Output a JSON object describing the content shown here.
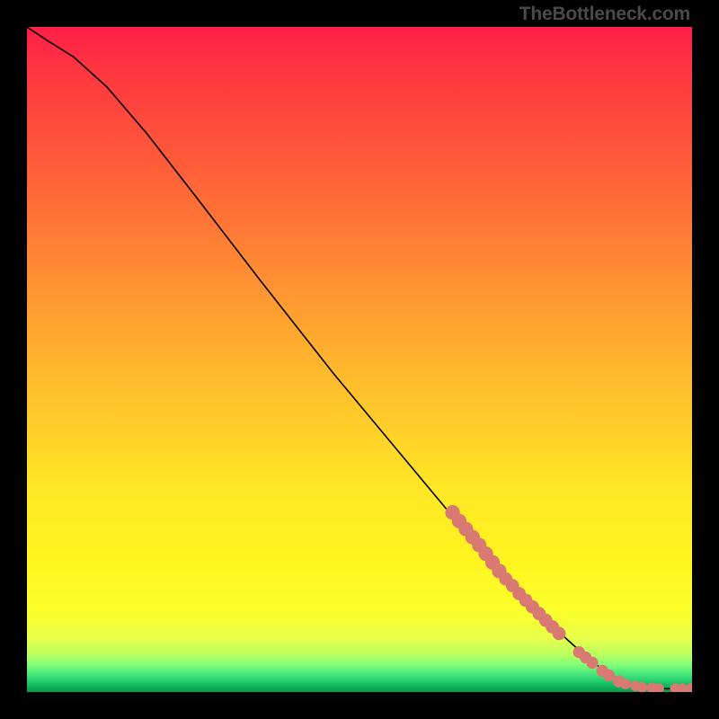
{
  "watermark": "TheBottleneck.com",
  "chart_data": {
    "type": "line",
    "title": "",
    "xlabel": "",
    "ylabel": "",
    "xlim": [
      0,
      100
    ],
    "ylim": [
      0,
      100
    ],
    "grid": false,
    "legend": false,
    "curve": [
      {
        "x": 0,
        "y": 100
      },
      {
        "x": 3,
        "y": 98
      },
      {
        "x": 7,
        "y": 95.5
      },
      {
        "x": 12,
        "y": 91
      },
      {
        "x": 18,
        "y": 84
      },
      {
        "x": 25,
        "y": 75
      },
      {
        "x": 35,
        "y": 62
      },
      {
        "x": 46,
        "y": 48
      },
      {
        "x": 56,
        "y": 36
      },
      {
        "x": 66,
        "y": 24
      },
      {
        "x": 74,
        "y": 15
      },
      {
        "x": 80,
        "y": 9
      },
      {
        "x": 85,
        "y": 4.5
      },
      {
        "x": 89,
        "y": 1.8
      },
      {
        "x": 92,
        "y": 0.8
      },
      {
        "x": 95,
        "y": 0.5
      },
      {
        "x": 100,
        "y": 0.5
      }
    ],
    "marker_clusters": [
      {
        "x": 64,
        "y": 27.0,
        "r": 1.1
      },
      {
        "x": 65,
        "y": 25.7,
        "r": 1.1
      },
      {
        "x": 66,
        "y": 24.5,
        "r": 1.1
      },
      {
        "x": 67,
        "y": 23.3,
        "r": 1.1
      },
      {
        "x": 68,
        "y": 22.1,
        "r": 1.1
      },
      {
        "x": 69,
        "y": 20.8,
        "r": 1.1
      },
      {
        "x": 70,
        "y": 19.5,
        "r": 1.1
      },
      {
        "x": 71,
        "y": 18.2,
        "r": 1.1
      },
      {
        "x": 72,
        "y": 17.0,
        "r": 1.0
      },
      {
        "x": 73,
        "y": 16.0,
        "r": 1.0
      },
      {
        "x": 74,
        "y": 14.8,
        "r": 1.0
      },
      {
        "x": 75,
        "y": 13.8,
        "r": 1.0
      },
      {
        "x": 76,
        "y": 12.8,
        "r": 1.0
      },
      {
        "x": 77,
        "y": 11.8,
        "r": 1.0
      },
      {
        "x": 78,
        "y": 10.8,
        "r": 1.0
      },
      {
        "x": 79,
        "y": 9.8,
        "r": 1.0
      },
      {
        "x": 80,
        "y": 8.8,
        "r": 1.0
      },
      {
        "x": 83,
        "y": 6.0,
        "r": 0.9
      },
      {
        "x": 84,
        "y": 5.2,
        "r": 0.9
      },
      {
        "x": 85,
        "y": 4.4,
        "r": 0.9
      },
      {
        "x": 86.5,
        "y": 3.2,
        "r": 0.9
      },
      {
        "x": 87.5,
        "y": 2.5,
        "r": 0.9
      },
      {
        "x": 89,
        "y": 1.6,
        "r": 0.9
      },
      {
        "x": 90,
        "y": 1.2,
        "r": 0.8
      },
      {
        "x": 91.5,
        "y": 0.9,
        "r": 0.8
      },
      {
        "x": 92.5,
        "y": 0.7,
        "r": 0.8
      },
      {
        "x": 94,
        "y": 0.6,
        "r": 0.8
      },
      {
        "x": 95,
        "y": 0.5,
        "r": 0.8
      },
      {
        "x": 97.5,
        "y": 0.5,
        "r": 0.8
      },
      {
        "x": 98.5,
        "y": 0.5,
        "r": 0.8
      },
      {
        "x": 100,
        "y": 0.5,
        "r": 0.9
      }
    ],
    "colors": {
      "curve": "#000000",
      "marker_fill": "#d87a72",
      "marker_stroke": "#d87a72"
    }
  }
}
